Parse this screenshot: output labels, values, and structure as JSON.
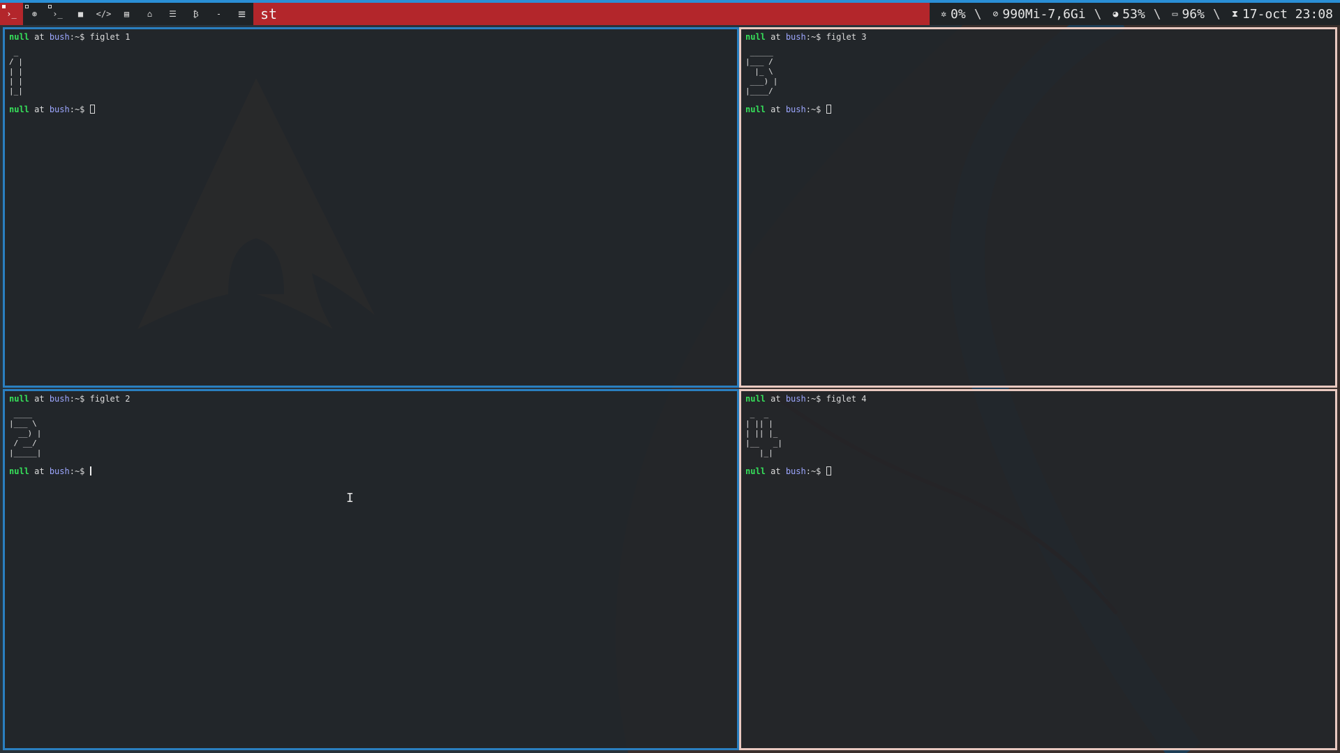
{
  "colors": {
    "bar_bg": "#1f2326",
    "accent_red": "#b3262b",
    "focus_border": "#2a7fc0",
    "unfocused_border": "#e9c9c0",
    "terminal_bg": "#222629",
    "prompt_user": "#36e05a",
    "prompt_host": "#9da7ff"
  },
  "topbar": {
    "tags": [
      {
        "icon": "terminal-icon",
        "glyph": "›_",
        "active": true
      },
      {
        "icon": "firefox-icon",
        "glyph": "⊛",
        "active": false
      },
      {
        "icon": "terminal-icon",
        "glyph": "›_",
        "active": false
      },
      {
        "icon": "folder-icon",
        "glyph": "■",
        "active": false
      },
      {
        "icon": "code-icon",
        "glyph": "</>",
        "active": false
      },
      {
        "icon": "film-icon",
        "glyph": "▤",
        "active": false
      },
      {
        "icon": "bank-icon",
        "glyph": "⌂",
        "active": false
      },
      {
        "icon": "database-icon",
        "glyph": "☰",
        "active": false
      },
      {
        "icon": "bitcoin-icon",
        "glyph": "₿",
        "active": false
      },
      {
        "icon": "dash-icon",
        "glyph": "-",
        "active": false
      }
    ],
    "layout_glyph": "≡",
    "window_title": "st",
    "status": {
      "cpu": "0%",
      "memory": "990Mi-7,6Gi",
      "disk": "53%",
      "battery": "96%",
      "datetime": "17-oct 23:08",
      "separator": "\\"
    }
  },
  "panes": {
    "p1": {
      "user": "null",
      "at": "at",
      "host": "bush",
      "cwd": ":~$",
      "command": "figlet 1",
      "ascii": " _\n/ |\n| |\n| |\n|_|"
    },
    "p2": {
      "user": "null",
      "at": "at",
      "host": "bush",
      "cwd": ":~$",
      "command": "figlet 2",
      "ascii": " ____\n|___ \\\n  __) |\n / __/\n|_____|"
    },
    "p3": {
      "user": "null",
      "at": "at",
      "host": "bush",
      "cwd": ":~$",
      "command": "figlet 3",
      "ascii": " _____\n|___ /\n  |_ \\\n ___) |\n|____/"
    },
    "p4": {
      "user": "null",
      "at": "at",
      "host": "bush",
      "cwd": ":~$",
      "command": "figlet 4",
      "ascii": " _  _\n| || |\n| || |_\n|__   _|\n   |_|"
    }
  }
}
